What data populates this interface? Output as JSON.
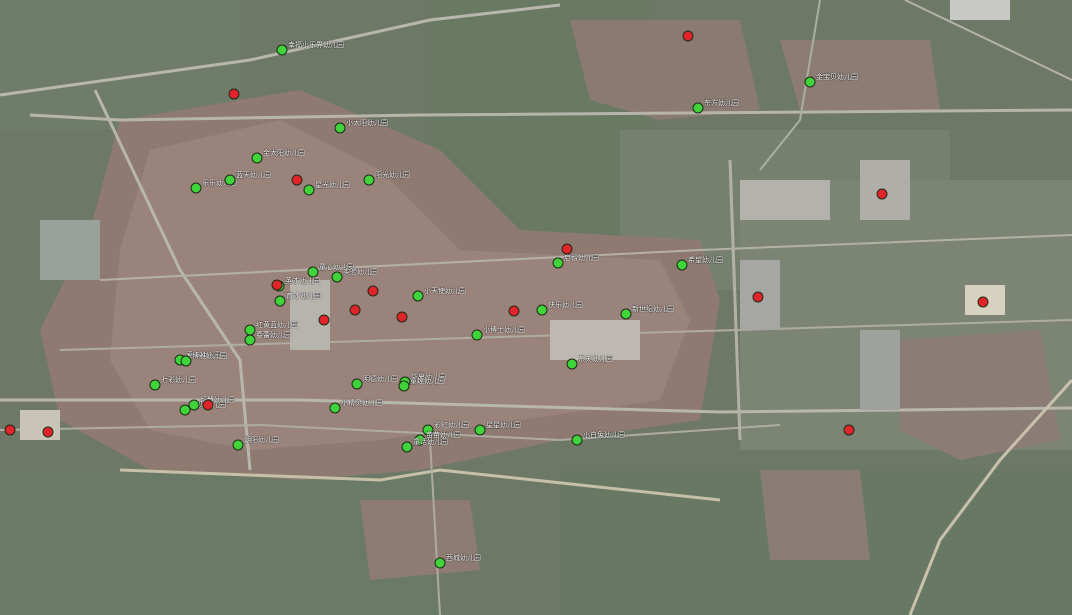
{
  "colors": {
    "school": "#3fd43a",
    "other": "#e0242a"
  },
  "schools": [
    {
      "name": "",
      "label": "幸福小乐界幼儿园"
    },
    {
      "name": "",
      "label": "东方幼儿园"
    },
    {
      "name": "",
      "label": "金宝贝幼儿园"
    },
    {
      "name": "",
      "label": "小太阳幼儿园"
    },
    {
      "name": "",
      "label": "金太阳幼儿园"
    },
    {
      "name": "",
      "label": "乐乐幼儿园"
    },
    {
      "name": "",
      "label": "蓝天幼儿园"
    },
    {
      "name": "",
      "label": "星光幼儿园"
    },
    {
      "name": "",
      "label": "阳光幼儿园"
    },
    {
      "name": "",
      "label": "童心幼儿园"
    },
    {
      "name": "",
      "label": "实验幼儿园"
    },
    {
      "name": "",
      "label": "英才幼儿园"
    },
    {
      "name": "",
      "label": "育才幼儿园"
    },
    {
      "name": "",
      "label": "小天使幼儿园"
    },
    {
      "name": "",
      "label": "启智幼儿园"
    },
    {
      "name": "",
      "label": "希望幼儿园"
    },
    {
      "name": "",
      "label": "快乐幼儿园"
    },
    {
      "name": "",
      "label": "新世纪幼儿园"
    },
    {
      "name": "",
      "label": "小博士幼儿园"
    },
    {
      "name": "",
      "label": "红黄蓝幼儿园"
    },
    {
      "name": "",
      "label": "春蕾幼儿园"
    },
    {
      "name": "",
      "label": "爱心幼儿园"
    },
    {
      "name": "",
      "label": "博雅幼儿园"
    },
    {
      "name": "",
      "label": "七彩幼儿园"
    },
    {
      "name": "",
      "label": "明德幼儿园"
    },
    {
      "name": "",
      "label": "华夏幼儿园"
    },
    {
      "name": "",
      "label": "童趣幼儿园"
    },
    {
      "name": "",
      "label": "小精灵幼儿园"
    },
    {
      "name": "",
      "label": "贝贝幼儿园"
    },
    {
      "name": "",
      "label": "智慧幼儿园"
    },
    {
      "name": "",
      "label": "朝阳幼儿园"
    },
    {
      "name": "",
      "label": "彩虹幼儿园"
    },
    {
      "name": "",
      "label": "苗苗幼儿园"
    },
    {
      "name": "",
      "label": "童话幼儿园"
    },
    {
      "name": "",
      "label": "星星幼儿园"
    },
    {
      "name": "",
      "label": "小白兔幼儿园"
    },
    {
      "name": "",
      "label": "东关幼儿园"
    },
    {
      "name": "",
      "label": "西城幼儿园"
    }
  ]
}
